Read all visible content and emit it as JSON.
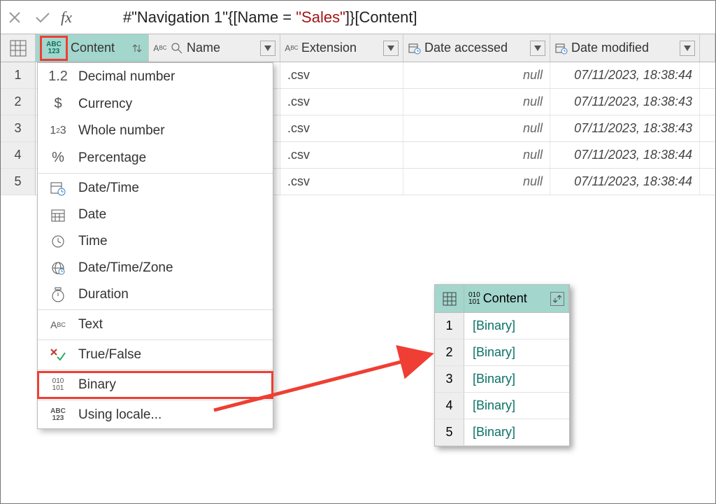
{
  "formula_bar": {
    "prefix": "#\"Navigation 1\"{[Name = ",
    "str": "\"Sales\"",
    "suffix": "]}[Content]"
  },
  "columns": {
    "content": "Content",
    "name": "Name",
    "extension": "Extension",
    "date_accessed": "Date accessed",
    "date_modified": "Date modified"
  },
  "rows": [
    {
      "n": "1",
      "ext": ".csv",
      "accessed": "null",
      "modified": "07/11/2023, 18:38:44"
    },
    {
      "n": "2",
      "ext": ".csv",
      "accessed": "null",
      "modified": "07/11/2023, 18:38:43"
    },
    {
      "n": "3",
      "ext": ".csv",
      "accessed": "null",
      "modified": "07/11/2023, 18:38:43"
    },
    {
      "n": "4",
      "ext": ".csv",
      "accessed": "null",
      "modified": "07/11/2023, 18:38:44"
    },
    {
      "n": "5",
      "ext": ".csv",
      "accessed": "null",
      "modified": "07/11/2023, 18:38:44"
    }
  ],
  "menu": {
    "decimal": "Decimal number",
    "currency": "Currency",
    "whole": "Whole number",
    "percent": "Percentage",
    "datetime": "Date/Time",
    "date": "Date",
    "time": "Time",
    "zone": "Date/Time/Zone",
    "duration": "Duration",
    "text": "Text",
    "truefalse": "True/False",
    "binary": "Binary",
    "locale": "Using locale..."
  },
  "mini": {
    "header": "Content",
    "rows": [
      {
        "n": "1",
        "v": "[Binary]"
      },
      {
        "n": "2",
        "v": "[Binary]"
      },
      {
        "n": "3",
        "v": "[Binary]"
      },
      {
        "n": "4",
        "v": "[Binary]"
      },
      {
        "n": "5",
        "v": "[Binary]"
      }
    ]
  },
  "icons": {
    "abc123": "ABC\n123",
    "bin": "010\n101"
  }
}
